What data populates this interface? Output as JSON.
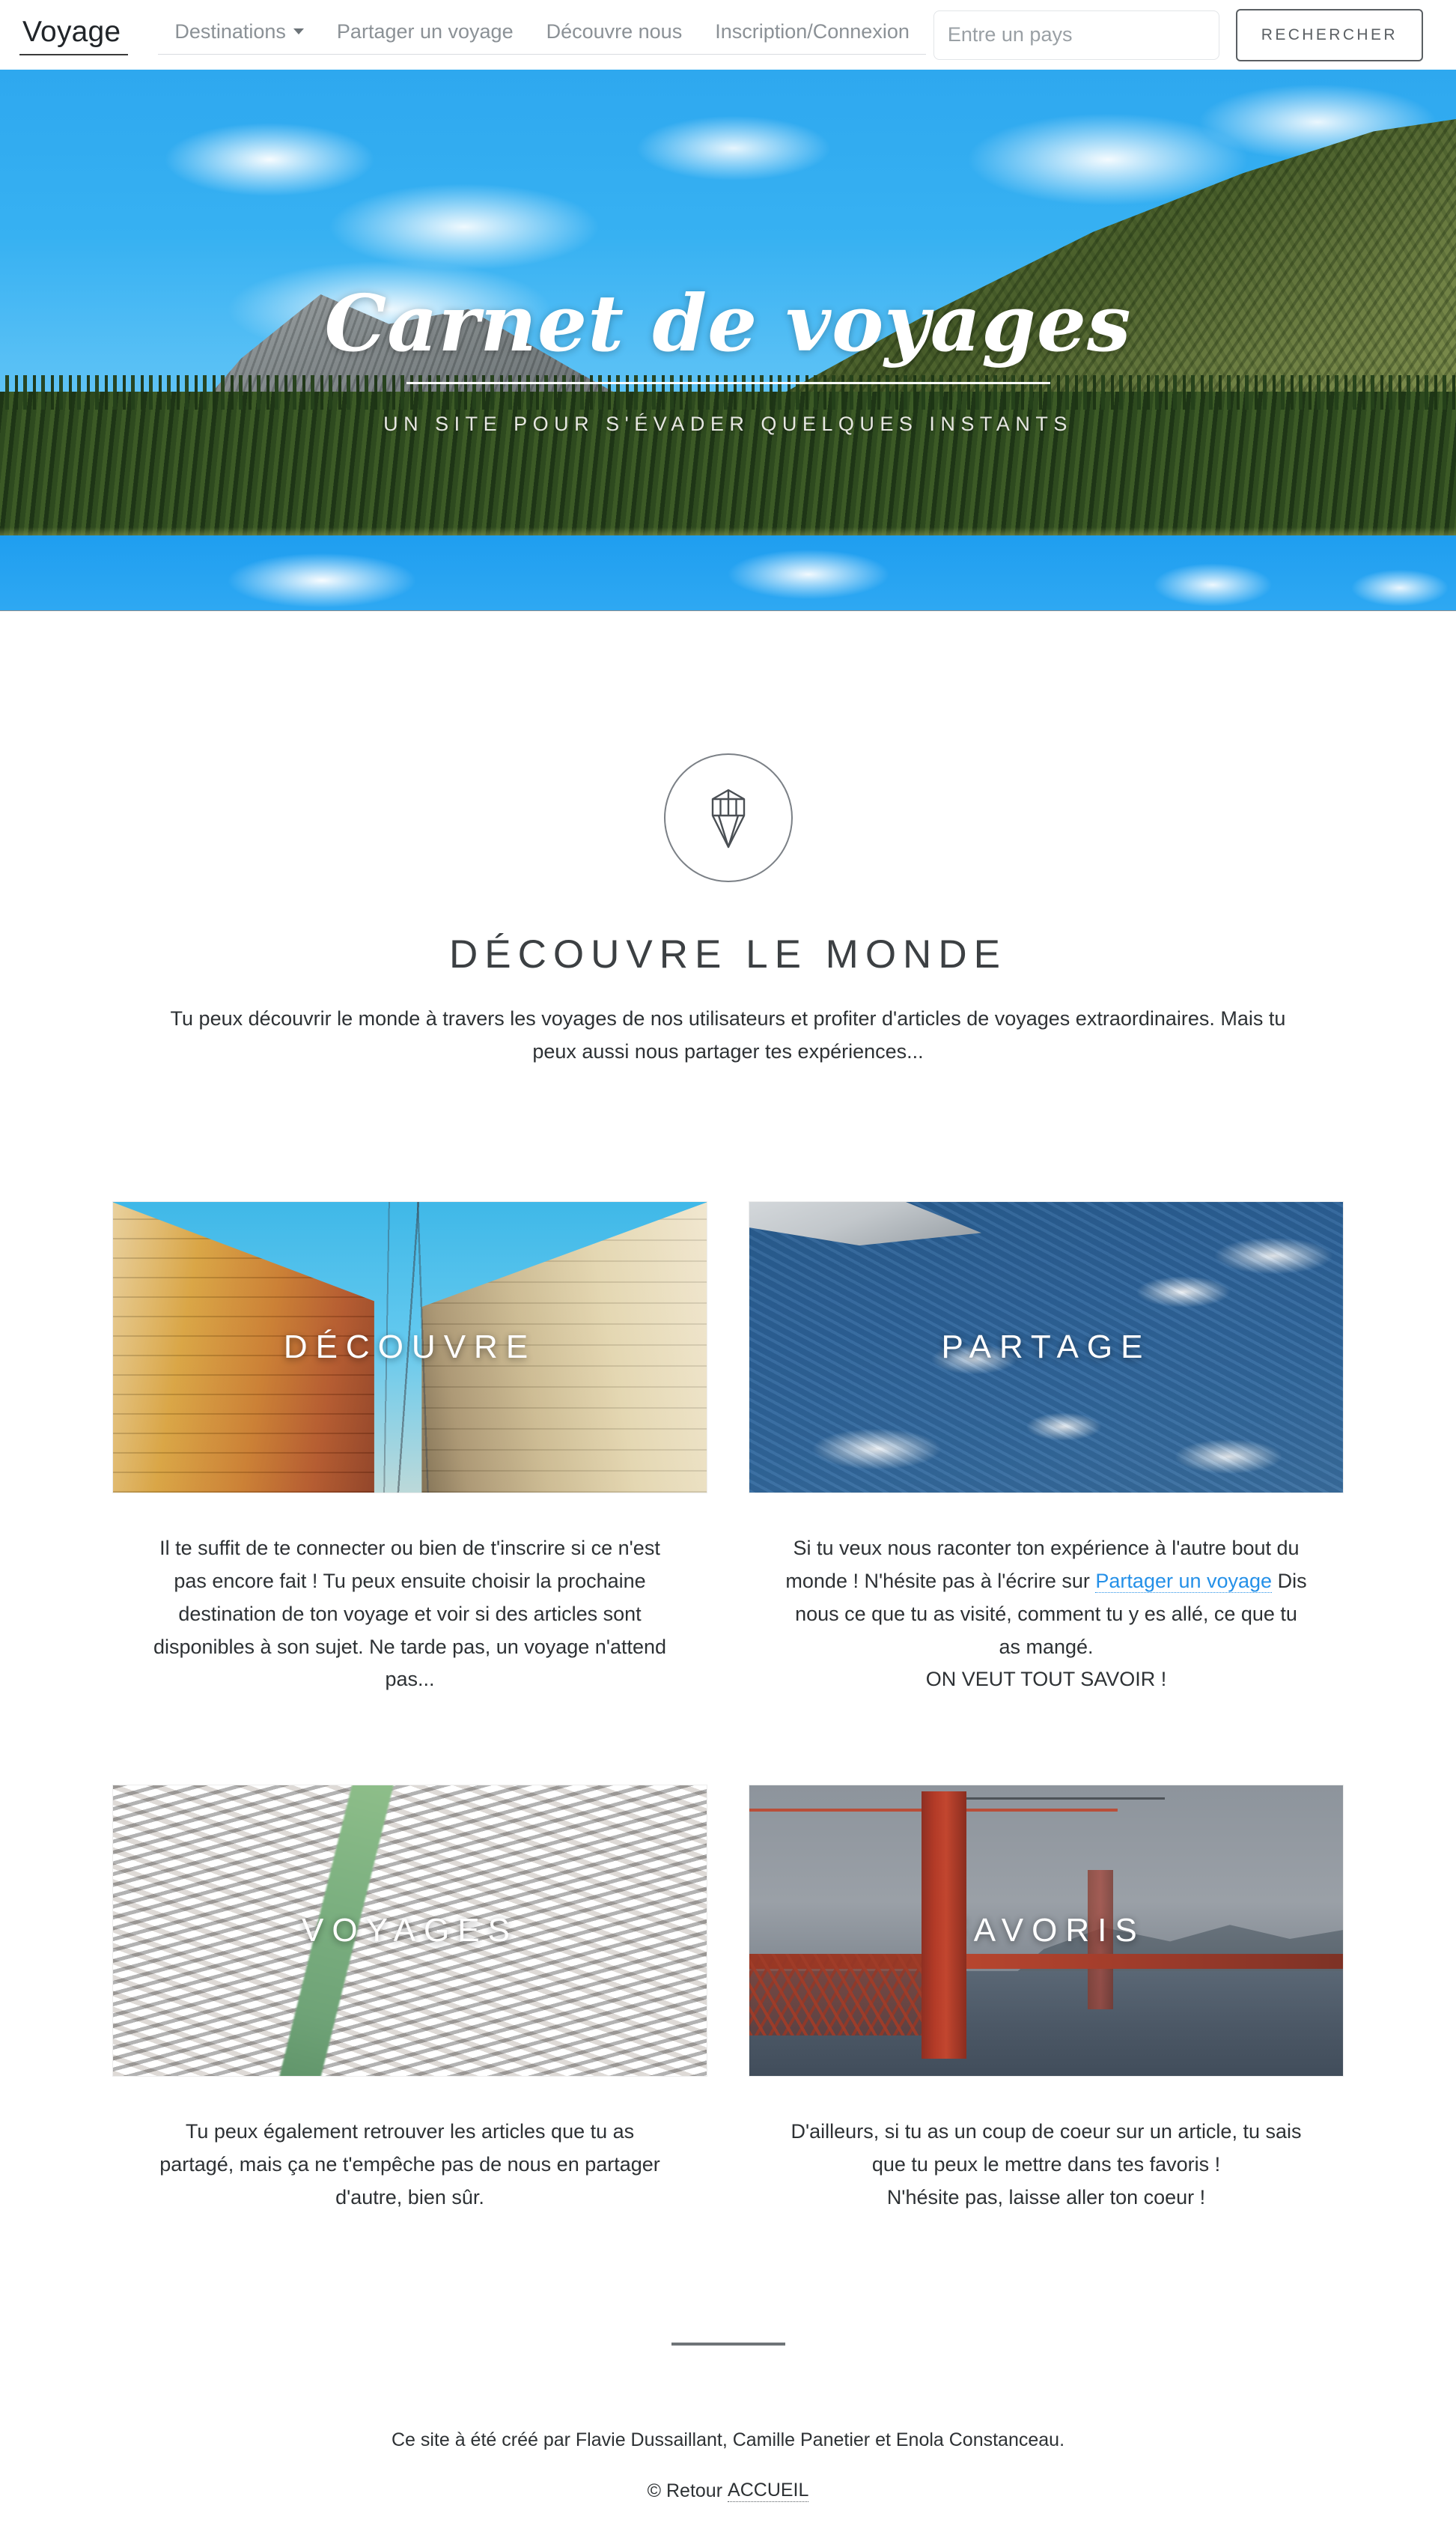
{
  "navbar": {
    "brand": "Voyage",
    "links": [
      {
        "label": "Destinations",
        "has_caret": true,
        "icon": "chevron-down-icon"
      },
      {
        "label": "Partager un voyage",
        "has_caret": false
      },
      {
        "label": "Découvre nous",
        "has_caret": false
      },
      {
        "label": "Inscription/Connexion",
        "has_caret": false
      }
    ],
    "search": {
      "placeholder": "Entre un pays",
      "value": "",
      "button_label": "RECHERCHER"
    }
  },
  "hero": {
    "title": "Carnet de voyages",
    "subtitle": "UN SITE POUR S'ÉVADER QUELQUES INSTANTS",
    "image_alt": "Lac de montagne avec forêt et ciel bleu"
  },
  "intro": {
    "icon": "diamond-gem-icon",
    "title": "DÉCOUVRE LE MONDE",
    "text": "Tu peux découvrir le monde à travers les voyages de nos utilisateurs et profiter d'articles de voyages extraordinaires. Mais tu peux aussi nous partager tes expériences..."
  },
  "cards": [
    {
      "label": "DÉCOUVRE",
      "image_alt": "Rue méditerranéenne avec bâtiments colorés",
      "text_parts": [
        {
          "type": "text",
          "value": "Il te suffit de te connecter ou bien de t'inscrire si ce n'est pas encore fait ! Tu peux ensuite choisir la prochaine destination de ton voyage et voir si des articles sont disponibles à son sujet. Ne tarde pas, un voyage n'attend pas..."
        }
      ]
    },
    {
      "label": "PARTAGE",
      "image_alt": "Vue aérienne depuis un avion avec nuages",
      "text_parts": [
        {
          "type": "text",
          "value": "Si tu veux nous raconter ton expérience à l'autre bout du monde ! N'hésite pas à l'écrire sur "
        },
        {
          "type": "link",
          "value": "Partager un voyage"
        },
        {
          "type": "text",
          "value": " Dis nous ce que tu as visité, comment tu y es allé, ce que tu as mangé."
        },
        {
          "type": "break",
          "value": ""
        },
        {
          "type": "text",
          "value": "ON VEUT TOUT SAVOIR !"
        }
      ]
    },
    {
      "label": "VOYAGES",
      "image_alt": "Grand Canyon avec le fleuve Colorado",
      "text_parts": [
        {
          "type": "text",
          "value": "Tu peux également retrouver les articles que tu as partagé, mais ça ne t'empêche pas de nous en partager d'autre, bien sûr."
        }
      ]
    },
    {
      "label": "FAVORIS",
      "image_alt": "Golden Gate Bridge sous un ciel gris",
      "text_parts": [
        {
          "type": "text",
          "value": "D'ailleurs, si tu as un coup de coeur sur un article, tu sais que tu peux le mettre dans tes favoris !"
        },
        {
          "type": "break",
          "value": ""
        },
        {
          "type": "text",
          "value": "N'hésite pas, laisse aller ton coeur !"
        }
      ]
    }
  ],
  "footer": {
    "credit": "Ce site à été créé par Flavie Dussaillant, Camille Panetier et Enola Constanceau.",
    "copyright_symbol": "©",
    "home_prefix": "Retour",
    "home_link": "ACCUEIL"
  },
  "colors": {
    "link_blue": "#2490e8",
    "text_dark": "#2d3134",
    "muted_gray": "#8b9196",
    "rule_gray": "#6f7478"
  }
}
